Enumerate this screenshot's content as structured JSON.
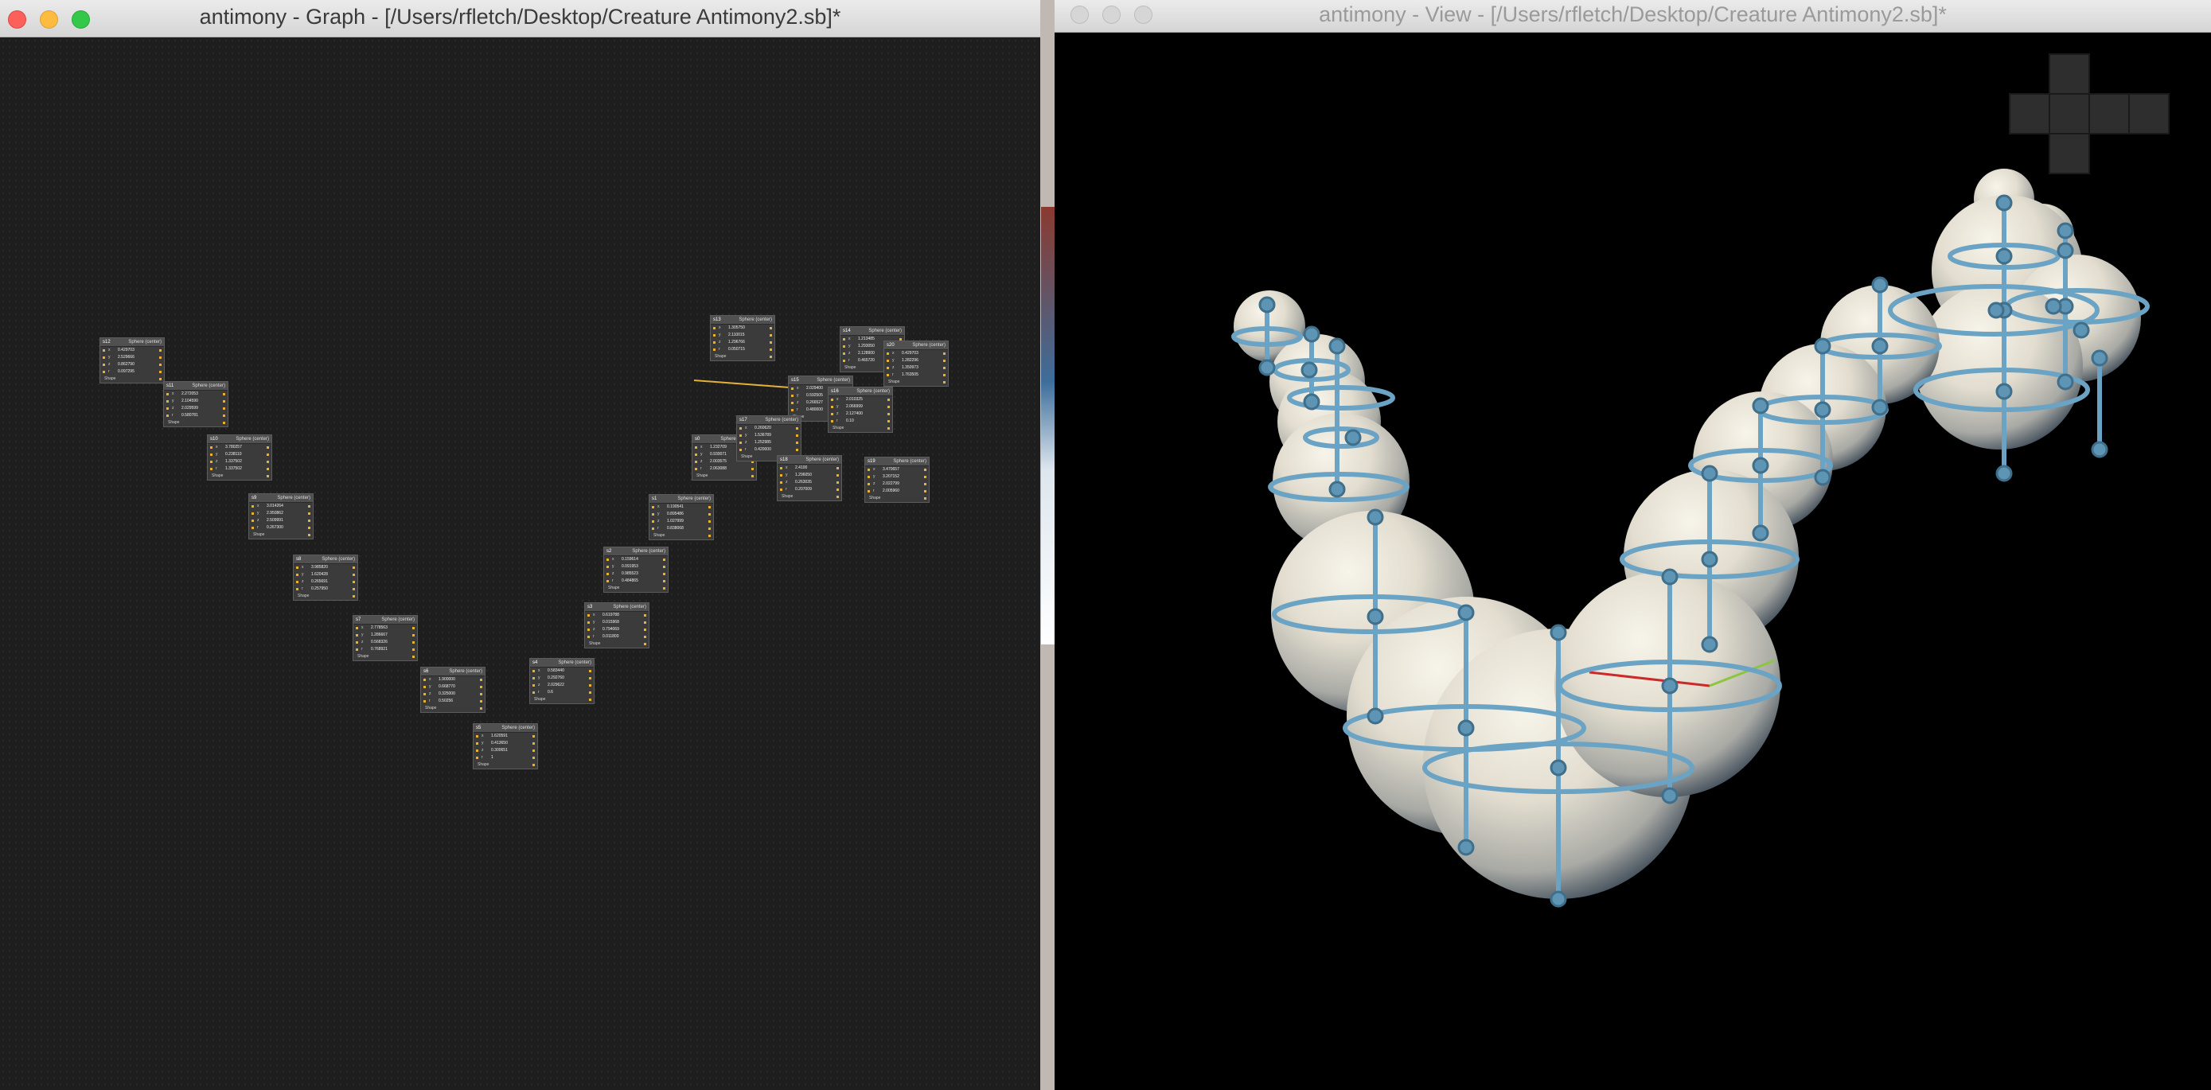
{
  "graph_window": {
    "title": "antimony - Graph - [/Users/rfletch/Desktop/Creature Antimony2.sb]*",
    "nodes": [
      {
        "name": "s12",
        "title": "Sphere (center)",
        "values": [
          "0.429703",
          "2.529666",
          "0.862790",
          "0.097295"
        ],
        "shape": "Shape"
      },
      {
        "name": "s11",
        "title": "Sphere (center)",
        "values": [
          "2.272053",
          "2.104590",
          "2.029599",
          "0.580781"
        ],
        "shape": "Shape"
      },
      {
        "name": "s10",
        "title": "Sphere (center)",
        "values": [
          "3.780257",
          "0.238110",
          "1.337502",
          "1.337502"
        ],
        "shape": "Shape"
      },
      {
        "name": "s9",
        "title": "Sphere (center)",
        "values": [
          "3.014264",
          "2.950862",
          "2.509991",
          "0.267300"
        ],
        "shape": "Shape"
      },
      {
        "name": "s8",
        "title": "Sphere (center)",
        "values": [
          "3.985820",
          "1.620428",
          "0.265691",
          "0.257950"
        ],
        "shape": "Shape"
      },
      {
        "name": "s7",
        "title": "Sphere (center)",
        "values": [
          "2.778563",
          "1.286667",
          "0.568326",
          "0.768921"
        ],
        "shape": "Shape"
      },
      {
        "name": "s6",
        "title": "Sphere (center)",
        "values": [
          "1.900000",
          "0.668770",
          "0.325000",
          "0.50256"
        ],
        "shape": "Shape"
      },
      {
        "name": "s5",
        "title": "Sphere (center)",
        "values": [
          "1.620591",
          "0.413650",
          "0.300651",
          "1"
        ],
        "shape": "Shape"
      },
      {
        "name": "s4",
        "title": "Sphere (center)",
        "values": [
          "0.583440",
          "0.292760",
          "2.029622",
          "0.6"
        ],
        "shape": "Shape"
      },
      {
        "name": "s3",
        "title": "Sphere (center)",
        "values": [
          "0.619788",
          "0.015968",
          "0.794069",
          "0.011800"
        ],
        "shape": "Shape"
      },
      {
        "name": "s2",
        "title": "Sphere (center)",
        "values": [
          "0.159614",
          "0.091953",
          "0.985523",
          "0.484865"
        ],
        "shape": "Shape"
      },
      {
        "name": "s1",
        "title": "Sphere (center)",
        "values": [
          "0.190541",
          "0.895486",
          "1.027999",
          "0.838068"
        ],
        "shape": "Shape"
      },
      {
        "name": "s0",
        "title": "Sphere (center)",
        "values": [
          "1.232709",
          "0.930071",
          "2.003575",
          "2.063088"
        ],
        "shape": "Shape"
      },
      {
        "name": "s13",
        "title": "Sphere (center)",
        "values": [
          "1.305750",
          "2.110015",
          "1.296766",
          "0.050715"
        ],
        "shape": "Shape"
      },
      {
        "name": "s14",
        "title": "Sphere (center)",
        "values": [
          "1.213485",
          "1.293050",
          "2.128900",
          "0.465720"
        ],
        "shape": "Shape"
      },
      {
        "name": "s15",
        "title": "Sphere (center)",
        "values": [
          "2.029400",
          "0.592505",
          "0.266527",
          "0.480000"
        ],
        "shape": "Shape"
      },
      {
        "name": "s16",
        "title": "Sphere (center)",
        "values": [
          "2.010325",
          "2.066999",
          "2.127400",
          "0.10"
        ],
        "shape": "Shape"
      },
      {
        "name": "s17",
        "title": "Sphere (center)",
        "values": [
          "0.260620",
          "1.536789",
          "1.252985",
          "0.420000"
        ],
        "shape": "Shape"
      },
      {
        "name": "s18",
        "title": "Sphere (center)",
        "values": [
          "2.4100",
          "1.296050",
          "0.263035",
          "0.207009"
        ],
        "shape": "Shape"
      },
      {
        "name": "s19",
        "title": "Sphere (center)",
        "values": [
          "3.470657",
          "3.207152",
          "2.022799",
          "2.005960"
        ],
        "shape": "Shape"
      },
      {
        "name": "s20",
        "title": "Sphere (center)",
        "values": [
          "0.429703",
          "1.282296",
          "1.350973",
          "1.763505"
        ],
        "shape": "Shape"
      }
    ]
  },
  "view_window": {
    "title": "antimony - View - [/Users/rfletch/Desktop/Creature Antimony2.sb]*",
    "colors": {
      "sphere": "#ece8dc",
      "handle": "#6aa3c4",
      "x_axis": "#cc2a2a",
      "y_axis": "#8cc63f"
    }
  }
}
